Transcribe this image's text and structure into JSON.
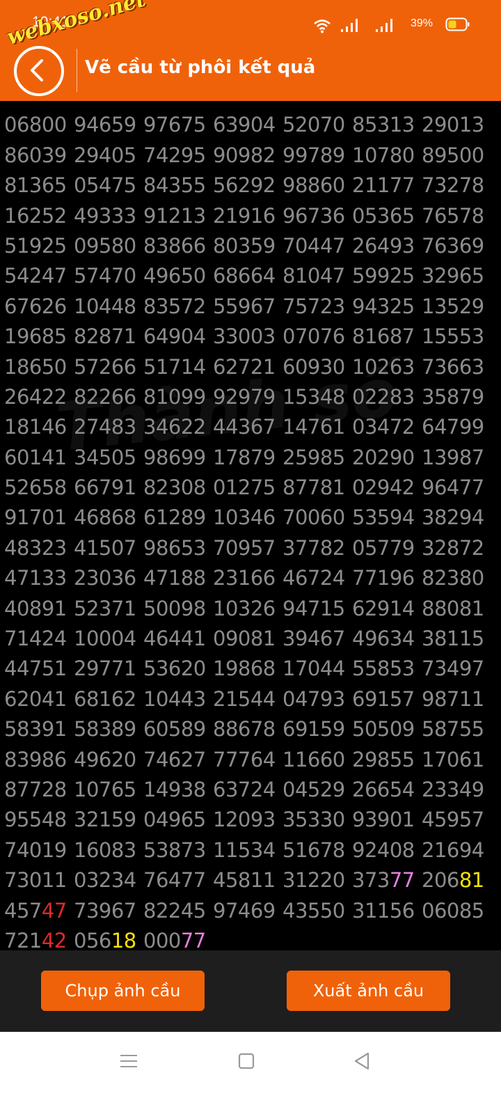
{
  "status_bar": {
    "time": "10:41",
    "battery": "39%"
  },
  "header": {
    "title": "Vẽ cầu từ phôi kết quả",
    "logo_text": "webxoso.net"
  },
  "background_watermark": "Thành số",
  "grid_rows": [
    [
      "06800",
      "94659",
      "97675",
      "63904",
      "52070",
      "85313",
      "29013"
    ],
    [
      "86039",
      "29405",
      "74295",
      "90982",
      "99789",
      "10780",
      "89500"
    ],
    [
      "81365",
      "05475",
      "84355",
      "56292",
      "98860",
      "21177",
      "73278"
    ],
    [
      "16252",
      "49333",
      "91213",
      "21916",
      "96736",
      "05365",
      "76578"
    ],
    [
      "51925",
      "09580",
      "83866",
      "80359",
      "70447",
      "26493",
      "76369"
    ],
    [
      "54247",
      "57470",
      "49650",
      "68664",
      "81047",
      "59925",
      "32965"
    ],
    [
      "67626",
      "10448",
      "83572",
      "55967",
      "75723",
      "94325",
      "13529"
    ],
    [
      "19685",
      "82871",
      "64904",
      "33003",
      "07076",
      "81687",
      "15553"
    ],
    [
      "18650",
      "57266",
      "51714",
      "62721",
      "60930",
      "10263",
      "73663"
    ],
    [
      "26422",
      "82266",
      "81099",
      "92979",
      "15348",
      "02283",
      "35879"
    ],
    [
      "18146",
      "27483",
      "34622",
      "44367",
      "14761",
      "03472",
      "64799"
    ],
    [
      "60141",
      "34505",
      "98699",
      "17879",
      "25985",
      "20290",
      "13987"
    ],
    [
      "52658",
      "66791",
      "82308",
      "01275",
      "87781",
      "02942",
      "96477"
    ],
    [
      "91701",
      "46868",
      "61289",
      "10346",
      "70060",
      "53594",
      "38294"
    ],
    [
      "48323",
      "41507",
      "98653",
      "70957",
      "37782",
      "05779",
      "32872"
    ],
    [
      "47133",
      "23036",
      "47188",
      "23166",
      "46724",
      "77196",
      "82380"
    ],
    [
      "40891",
      "52371",
      "50098",
      "10326",
      "94715",
      "62914",
      "88081"
    ],
    [
      "71424",
      "10004",
      "46441",
      "09081",
      "39467",
      "49634",
      "38115"
    ],
    [
      "44751",
      "29771",
      "53620",
      "19868",
      "17044",
      "55853",
      "73497"
    ],
    [
      "62041",
      "68162",
      "10443",
      "21544",
      "04793",
      "69157",
      "98711"
    ],
    [
      "58391",
      "58389",
      "60589",
      "88678",
      "69159",
      "50509",
      "58755"
    ],
    [
      "83986",
      "49620",
      "74627",
      "77764",
      "11660",
      "29855",
      "17061"
    ],
    [
      "87728",
      "10765",
      "14938",
      "63724",
      "04529",
      "26654",
      "23349"
    ],
    [
      "95548",
      "32159",
      "04965",
      "12093",
      "35330",
      "93901",
      "45957"
    ],
    [
      "74019",
      "16083",
      "53873",
      "11534",
      "51678",
      "92408",
      "21694"
    ],
    [
      "73011",
      "03234",
      "76477",
      "45811",
      "31220",
      "37377",
      "20681"
    ],
    [
      "45747",
      "73967",
      "82245",
      "97469",
      "43550",
      "31156",
      "06085"
    ],
    [
      "72142",
      "05618",
      "00077"
    ]
  ],
  "highlights": [
    {
      "row": 25,
      "col": 5,
      "color": "pink"
    },
    {
      "row": 25,
      "col": 6,
      "color": "yellow"
    },
    {
      "row": 26,
      "col": 0,
      "color": "red"
    },
    {
      "row": 27,
      "col": 0,
      "color": "red"
    },
    {
      "row": 27,
      "col": 1,
      "color": "yellow"
    },
    {
      "row": 27,
      "col": 2,
      "color": "pink"
    }
  ],
  "colors": {
    "header": "#F0620A",
    "number_text": "#8c8c8c",
    "red": "#E0292C",
    "yellow": "#F5E10B",
    "pink": "#E67FDB"
  },
  "actions": {
    "capture_label": "Chụp ảnh cầu",
    "export_label": "Xuất ảnh cầu"
  },
  "icons": [
    "back-arrow-icon",
    "wifi-icon",
    "signal-icon",
    "battery-icon",
    "menu-icon",
    "home-icon",
    "nav-back-icon"
  ]
}
